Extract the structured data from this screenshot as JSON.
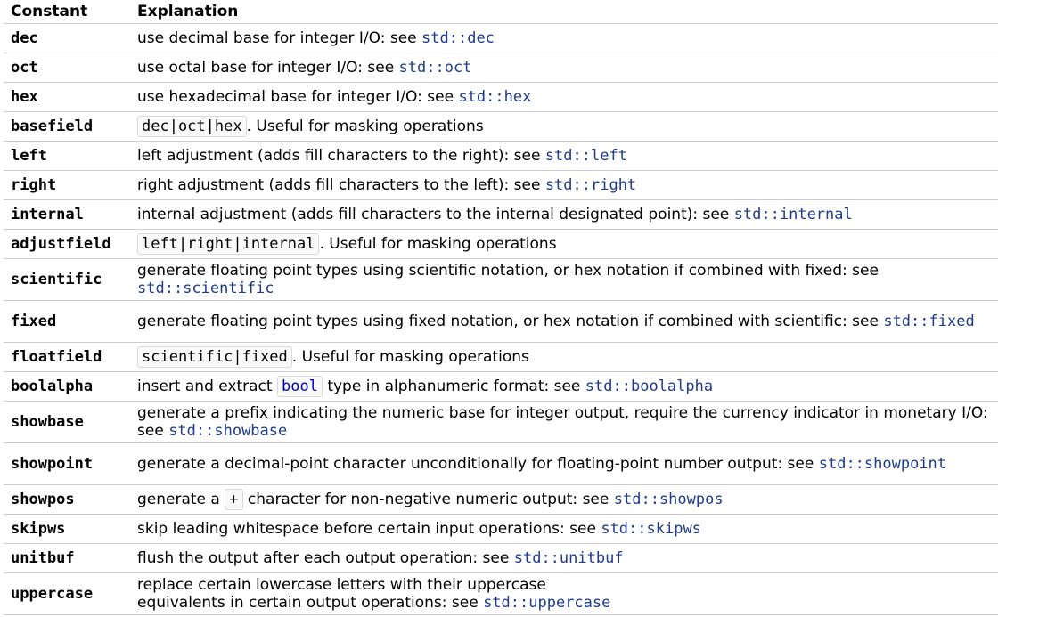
{
  "header": {
    "col1": "Constant",
    "col2": "Explanation"
  },
  "rows": [
    {
      "name": "dec",
      "pre": "use decimal base for integer I/O: see ",
      "link": "std::dec"
    },
    {
      "name": "oct",
      "pre": "use octal base for integer I/O: see ",
      "link": "std::oct"
    },
    {
      "name": "hex",
      "pre": "use hexadecimal base for integer I/O: see ",
      "link": "std::hex"
    },
    {
      "name": "basefield",
      "code": "dec|oct|hex",
      "post": ". Useful for masking operations"
    },
    {
      "name": "left",
      "pre": "left adjustment (adds fill characters to the right): see ",
      "link": "std::left"
    },
    {
      "name": "right",
      "pre": "right adjustment (adds fill characters to the left): see ",
      "link": "std::right"
    },
    {
      "name": "internal",
      "pre": "internal adjustment (adds fill characters to the internal designated point): see ",
      "link": "std::internal"
    },
    {
      "name": "adjustfield",
      "code": "left|right|internal",
      "post": ". Useful for masking operations"
    },
    {
      "name": "scientific",
      "pre": "generate floating point types using scientific notation, or hex notation if combined with fixed: see ",
      "link": "std::scientific"
    },
    {
      "name": "fixed",
      "pre": "generate floating point types using fixed notation, or hex notation if combined with scientific: see ",
      "link": "std::fixed"
    },
    {
      "name": "floatfield",
      "code": "scientific|fixed",
      "post": ". Useful for masking operations"
    },
    {
      "name": "boolalpha",
      "pre": "insert and extract ",
      "code": "bool",
      "mid": " type in alphanumeric format: see ",
      "link": "std::boolalpha"
    },
    {
      "name": "showbase",
      "pre": "generate a prefix indicating the numeric base for integer output, require the currency indicator in monetary I/O: see ",
      "link": "std::showbase"
    },
    {
      "name": "showpoint",
      "pre": "generate a decimal-point character unconditionally for floating-point number output: see ",
      "link": "std::showpoint"
    },
    {
      "name": "showpos",
      "pre": "generate a ",
      "code": "+",
      "mid": " character for non-negative numeric output: see ",
      "link": "std::showpos"
    },
    {
      "name": "skipws",
      "pre": "skip leading whitespace before certain input operations: see ",
      "link": "std::skipws"
    },
    {
      "name": "unitbuf",
      "pre": "flush the output after each output operation: see ",
      "link": "std::unitbuf"
    },
    {
      "name": "uppercase",
      "pre": "replace certain lowercase letters with their uppercase",
      "pre2": "equivalents in certain output operations: see ",
      "link": "std::uppercase"
    }
  ]
}
